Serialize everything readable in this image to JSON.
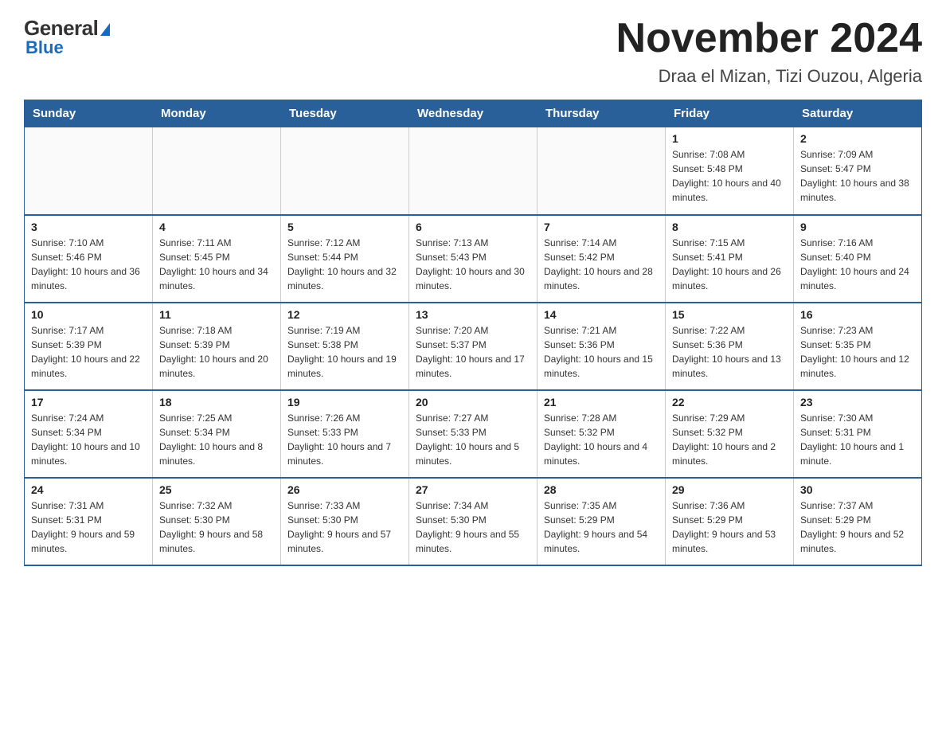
{
  "logo": {
    "general": "General",
    "blue": "Blue",
    "triangle": "▶"
  },
  "header": {
    "title": "November 2024",
    "subtitle": "Draa el Mizan, Tizi Ouzou, Algeria"
  },
  "days_of_week": [
    "Sunday",
    "Monday",
    "Tuesday",
    "Wednesday",
    "Thursday",
    "Friday",
    "Saturday"
  ],
  "weeks": [
    [
      {
        "day": "",
        "info": ""
      },
      {
        "day": "",
        "info": ""
      },
      {
        "day": "",
        "info": ""
      },
      {
        "day": "",
        "info": ""
      },
      {
        "day": "",
        "info": ""
      },
      {
        "day": "1",
        "info": "Sunrise: 7:08 AM\nSunset: 5:48 PM\nDaylight: 10 hours and 40 minutes."
      },
      {
        "day": "2",
        "info": "Sunrise: 7:09 AM\nSunset: 5:47 PM\nDaylight: 10 hours and 38 minutes."
      }
    ],
    [
      {
        "day": "3",
        "info": "Sunrise: 7:10 AM\nSunset: 5:46 PM\nDaylight: 10 hours and 36 minutes."
      },
      {
        "day": "4",
        "info": "Sunrise: 7:11 AM\nSunset: 5:45 PM\nDaylight: 10 hours and 34 minutes."
      },
      {
        "day": "5",
        "info": "Sunrise: 7:12 AM\nSunset: 5:44 PM\nDaylight: 10 hours and 32 minutes."
      },
      {
        "day": "6",
        "info": "Sunrise: 7:13 AM\nSunset: 5:43 PM\nDaylight: 10 hours and 30 minutes."
      },
      {
        "day": "7",
        "info": "Sunrise: 7:14 AM\nSunset: 5:42 PM\nDaylight: 10 hours and 28 minutes."
      },
      {
        "day": "8",
        "info": "Sunrise: 7:15 AM\nSunset: 5:41 PM\nDaylight: 10 hours and 26 minutes."
      },
      {
        "day": "9",
        "info": "Sunrise: 7:16 AM\nSunset: 5:40 PM\nDaylight: 10 hours and 24 minutes."
      }
    ],
    [
      {
        "day": "10",
        "info": "Sunrise: 7:17 AM\nSunset: 5:39 PM\nDaylight: 10 hours and 22 minutes."
      },
      {
        "day": "11",
        "info": "Sunrise: 7:18 AM\nSunset: 5:39 PM\nDaylight: 10 hours and 20 minutes."
      },
      {
        "day": "12",
        "info": "Sunrise: 7:19 AM\nSunset: 5:38 PM\nDaylight: 10 hours and 19 minutes."
      },
      {
        "day": "13",
        "info": "Sunrise: 7:20 AM\nSunset: 5:37 PM\nDaylight: 10 hours and 17 minutes."
      },
      {
        "day": "14",
        "info": "Sunrise: 7:21 AM\nSunset: 5:36 PM\nDaylight: 10 hours and 15 minutes."
      },
      {
        "day": "15",
        "info": "Sunrise: 7:22 AM\nSunset: 5:36 PM\nDaylight: 10 hours and 13 minutes."
      },
      {
        "day": "16",
        "info": "Sunrise: 7:23 AM\nSunset: 5:35 PM\nDaylight: 10 hours and 12 minutes."
      }
    ],
    [
      {
        "day": "17",
        "info": "Sunrise: 7:24 AM\nSunset: 5:34 PM\nDaylight: 10 hours and 10 minutes."
      },
      {
        "day": "18",
        "info": "Sunrise: 7:25 AM\nSunset: 5:34 PM\nDaylight: 10 hours and 8 minutes."
      },
      {
        "day": "19",
        "info": "Sunrise: 7:26 AM\nSunset: 5:33 PM\nDaylight: 10 hours and 7 minutes."
      },
      {
        "day": "20",
        "info": "Sunrise: 7:27 AM\nSunset: 5:33 PM\nDaylight: 10 hours and 5 minutes."
      },
      {
        "day": "21",
        "info": "Sunrise: 7:28 AM\nSunset: 5:32 PM\nDaylight: 10 hours and 4 minutes."
      },
      {
        "day": "22",
        "info": "Sunrise: 7:29 AM\nSunset: 5:32 PM\nDaylight: 10 hours and 2 minutes."
      },
      {
        "day": "23",
        "info": "Sunrise: 7:30 AM\nSunset: 5:31 PM\nDaylight: 10 hours and 1 minute."
      }
    ],
    [
      {
        "day": "24",
        "info": "Sunrise: 7:31 AM\nSunset: 5:31 PM\nDaylight: 9 hours and 59 minutes."
      },
      {
        "day": "25",
        "info": "Sunrise: 7:32 AM\nSunset: 5:30 PM\nDaylight: 9 hours and 58 minutes."
      },
      {
        "day": "26",
        "info": "Sunrise: 7:33 AM\nSunset: 5:30 PM\nDaylight: 9 hours and 57 minutes."
      },
      {
        "day": "27",
        "info": "Sunrise: 7:34 AM\nSunset: 5:30 PM\nDaylight: 9 hours and 55 minutes."
      },
      {
        "day": "28",
        "info": "Sunrise: 7:35 AM\nSunset: 5:29 PM\nDaylight: 9 hours and 54 minutes."
      },
      {
        "day": "29",
        "info": "Sunrise: 7:36 AM\nSunset: 5:29 PM\nDaylight: 9 hours and 53 minutes."
      },
      {
        "day": "30",
        "info": "Sunrise: 7:37 AM\nSunset: 5:29 PM\nDaylight: 9 hours and 52 minutes."
      }
    ]
  ]
}
